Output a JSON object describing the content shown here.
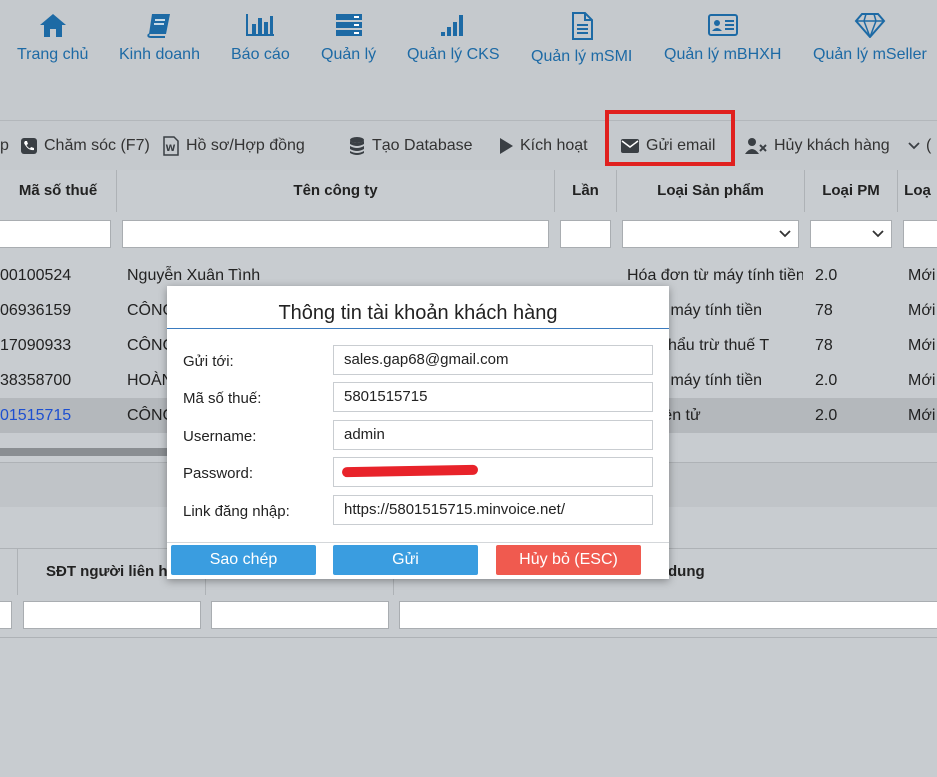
{
  "nav": {
    "items": [
      {
        "label": "Trang chủ",
        "icon": "home-icon"
      },
      {
        "label": "Kinh doanh",
        "icon": "book-icon"
      },
      {
        "label": "Báo cáo",
        "icon": "bar-chart-icon"
      },
      {
        "label": "Quản lý",
        "icon": "server-icon"
      },
      {
        "label": "Quản lý CKS",
        "icon": "signal-icon"
      },
      {
        "label": "Quản lý mSMI",
        "icon": "document-icon"
      },
      {
        "label": "Quản lý mBHXH",
        "icon": "id-card-icon"
      },
      {
        "label": "Quản lý mSeller",
        "icon": "diamond-icon"
      }
    ]
  },
  "toolbar": {
    "partial_left": "p",
    "cham_soc": "Chăm sóc (F7)",
    "ho_so": "Hồ sơ/Hợp đồng",
    "tao_database": "Tạo Database",
    "kich_hoat": "Kích hoạt",
    "gui_email": "Gửi email",
    "huy_khach_hang": "Hủy khách hàng",
    "partial_right": "(",
    "accent": "#1d6aa5",
    "highlight_color": "#e0201e"
  },
  "grid": {
    "headers": [
      "Mã số thuế",
      "Tên công ty",
      "Lần",
      "Loại Sản phẩm",
      "Loại PM",
      "Loạ"
    ],
    "rows": [
      {
        "mst": "00100524",
        "ten": "Nguyễn Xuân Tình",
        "loai_sp": "Hóa đơn từ máy tính tiền",
        "loai_pm": "2.0",
        "loai": "Mới"
      },
      {
        "mst": "06936159",
        "ten": "CÔNG",
        "loai_sp": "ơn từ máy tính tiền",
        "loai_pm": "78",
        "loai": "Mới"
      },
      {
        "mst": "17090933",
        "ten": "CÔNG",
        "loai_sp": "g từ khẩu trừ thuế T",
        "loai_pm": "78",
        "loai": "Mới"
      },
      {
        "mst": "38358700",
        "ten": "HOÀN",
        "loai_sp": "ơn từ máy tính tiền",
        "loai_pm": "2.0",
        "loai": "Mới"
      },
      {
        "mst": "01515715",
        "ten": "CÔNG",
        "loai_sp": "ơn điện tử",
        "loai_pm": "2.0",
        "loai": "Mới"
      }
    ]
  },
  "bottom_grid": {
    "headers": [
      "SĐT người liên h",
      "dung"
    ]
  },
  "dialog": {
    "title": "Thông tin tài khoản khách hàng",
    "fields": [
      {
        "label": "Gửi tới:",
        "value": "sales.gap68@gmail.com"
      },
      {
        "label": "Mã số thuế:",
        "value": "5801515715"
      },
      {
        "label": "Username:",
        "value": "admin"
      },
      {
        "label": "Password:",
        "value": ""
      },
      {
        "label": "Link đăng nhập:",
        "value": "https://5801515715.minvoice.net/"
      }
    ],
    "buttons": {
      "copy": "Sao chép",
      "send": "Gửi",
      "cancel": "Hủy bỏ (ESC)"
    }
  }
}
